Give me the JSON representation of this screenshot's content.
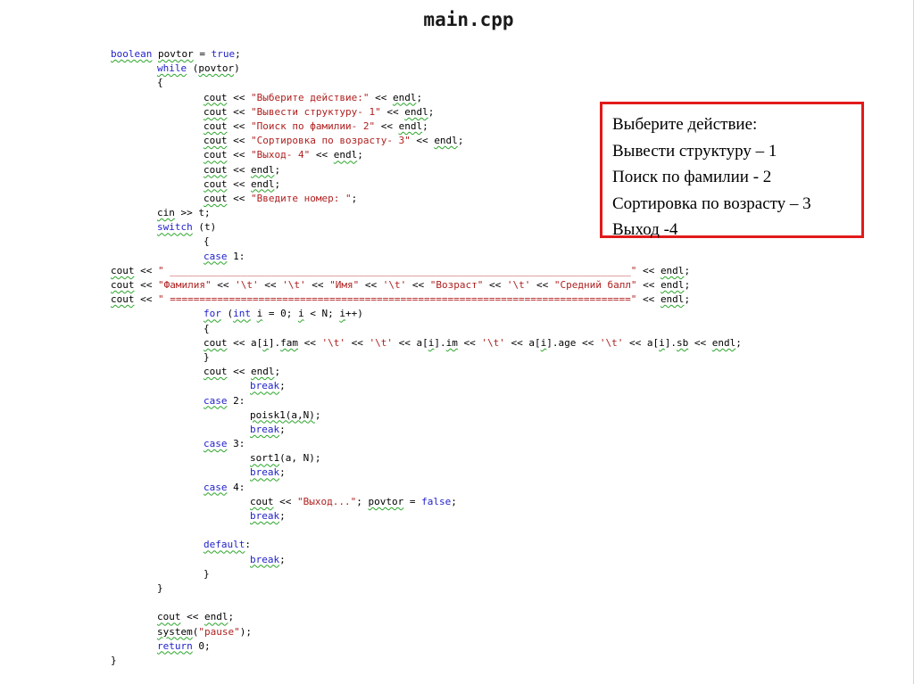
{
  "title": "main.cpp",
  "menu_output": [
    "Выберите действие:",
    "Вывести структуру – 1",
    "Поиск по фамилии - 2",
    "Сортировка по возрасту – 3",
    "Выход -4"
  ],
  "code": [
    {
      "ind": 0,
      "parts": [
        [
          "kw sq",
          "boolean"
        ],
        [
          "nm",
          " "
        ],
        [
          "nm sq",
          "povtor"
        ],
        [
          "nm",
          " = "
        ],
        [
          "kw",
          "true"
        ],
        [
          "nm",
          ";"
        ]
      ]
    },
    {
      "ind": 1,
      "parts": [
        [
          "kw sq",
          "while"
        ],
        [
          "nm",
          " ("
        ],
        [
          "nm sq",
          "povtor"
        ],
        [
          "nm",
          ")"
        ]
      ]
    },
    {
      "ind": 1,
      "parts": [
        [
          "nm",
          "{"
        ]
      ]
    },
    {
      "ind": 2,
      "parts": [
        [
          "nm sq",
          "cout"
        ],
        [
          "nm",
          " << "
        ],
        [
          "st",
          "\"Выберите действие:\""
        ],
        [
          "nm",
          " << "
        ],
        [
          "nm sq",
          "endl"
        ],
        [
          "nm",
          ";"
        ]
      ]
    },
    {
      "ind": 2,
      "parts": [
        [
          "nm sq",
          "cout"
        ],
        [
          "nm",
          " << "
        ],
        [
          "st",
          "\"Вывести структуру- 1\""
        ],
        [
          "nm",
          " << "
        ],
        [
          "nm sq",
          "endl"
        ],
        [
          "nm",
          ";"
        ]
      ]
    },
    {
      "ind": 2,
      "parts": [
        [
          "nm sq",
          "cout"
        ],
        [
          "nm",
          " << "
        ],
        [
          "st",
          "\"Поиск по фамилии- 2\""
        ],
        [
          "nm",
          " << "
        ],
        [
          "nm sq",
          "endl"
        ],
        [
          "nm",
          ";"
        ]
      ]
    },
    {
      "ind": 2,
      "parts": [
        [
          "nm sq",
          "cout"
        ],
        [
          "nm",
          " << "
        ],
        [
          "st",
          "\"Сортировка по возрасту- 3\""
        ],
        [
          "nm",
          " << "
        ],
        [
          "nm sq",
          "endl"
        ],
        [
          "nm",
          ";"
        ]
      ]
    },
    {
      "ind": 2,
      "parts": [
        [
          "nm sq",
          "cout"
        ],
        [
          "nm",
          " << "
        ],
        [
          "st",
          "\"Выход- 4\""
        ],
        [
          "nm",
          " << "
        ],
        [
          "nm sq",
          "endl"
        ],
        [
          "nm",
          ";"
        ]
      ]
    },
    {
      "ind": 2,
      "parts": [
        [
          "nm sq",
          "cout"
        ],
        [
          "nm",
          " << "
        ],
        [
          "nm sq",
          "endl"
        ],
        [
          "nm",
          ";"
        ]
      ]
    },
    {
      "ind": 2,
      "parts": [
        [
          "nm sq",
          "cout"
        ],
        [
          "nm",
          " << "
        ],
        [
          "nm sq",
          "endl"
        ],
        [
          "nm",
          ";"
        ]
      ]
    },
    {
      "ind": 2,
      "parts": [
        [
          "nm sq",
          "cout"
        ],
        [
          "nm",
          " << "
        ],
        [
          "st",
          "\"Введите номер: \""
        ],
        [
          "nm",
          ";"
        ]
      ]
    },
    {
      "ind": 1,
      "parts": [
        [
          "nm sq",
          "cin"
        ],
        [
          "nm",
          " >> t;"
        ]
      ]
    },
    {
      "ind": 1,
      "parts": [
        [
          "kw sq",
          "switch"
        ],
        [
          "nm",
          " (t)"
        ]
      ]
    },
    {
      "ind": 2,
      "parts": [
        [
          "nm",
          "{"
        ]
      ]
    },
    {
      "ind": 2,
      "parts": [
        [
          "kw sq",
          "case"
        ],
        [
          "nm",
          " 1:"
        ]
      ]
    },
    {
      "ind": 0,
      "parts": [
        [
          "nm sq",
          "cout"
        ],
        [
          "nm",
          " << "
        ],
        [
          "st",
          "\" ______________________________________________________________________________\""
        ],
        [
          "nm",
          " << "
        ],
        [
          "nm sq",
          "endl"
        ],
        [
          "nm",
          ";"
        ]
      ]
    },
    {
      "ind": 0,
      "parts": [
        [
          "nm sq",
          "cout"
        ],
        [
          "nm",
          " << "
        ],
        [
          "st",
          "\"Фамилия\""
        ],
        [
          "nm",
          " << "
        ],
        [
          "st",
          "'\\t'"
        ],
        [
          "nm",
          " << "
        ],
        [
          "st",
          "'\\t'"
        ],
        [
          "nm",
          " << "
        ],
        [
          "st",
          "\"Имя\""
        ],
        [
          "nm",
          " << "
        ],
        [
          "st",
          "'\\t'"
        ],
        [
          "nm",
          " << "
        ],
        [
          "st",
          "\"Возраст\""
        ],
        [
          "nm",
          " << "
        ],
        [
          "st",
          "'\\t'"
        ],
        [
          "nm",
          " << "
        ],
        [
          "st",
          "\"Средний балл\""
        ],
        [
          "nm",
          " << "
        ],
        [
          "nm sq",
          "endl"
        ],
        [
          "nm",
          ";"
        ]
      ]
    },
    {
      "ind": 0,
      "parts": [
        [
          "nm sq",
          "cout"
        ],
        [
          "nm",
          " << "
        ],
        [
          "st",
          "\" ==============================================================================\""
        ],
        [
          "nm",
          " << "
        ],
        [
          "nm sq",
          "endl"
        ],
        [
          "nm",
          ";"
        ]
      ]
    },
    {
      "ind": 2,
      "parts": [
        [
          "kw sq",
          "for"
        ],
        [
          "nm",
          " ("
        ],
        [
          "kw sq",
          "int"
        ],
        [
          "nm",
          " "
        ],
        [
          "nm sq",
          "i"
        ],
        [
          "nm",
          " = 0; "
        ],
        [
          "nm sq",
          "i"
        ],
        [
          "nm",
          " < N; "
        ],
        [
          "nm sq",
          "i"
        ],
        [
          "nm",
          "++)"
        ]
      ]
    },
    {
      "ind": 2,
      "parts": [
        [
          "nm",
          "{"
        ]
      ]
    },
    {
      "ind": 2,
      "parts": [
        [
          "nm sq",
          "cout"
        ],
        [
          "nm",
          " << a["
        ],
        [
          "nm sq",
          "i"
        ],
        [
          "nm",
          "]."
        ],
        [
          "nm sq",
          "fam"
        ],
        [
          "nm",
          " << "
        ],
        [
          "st",
          "'\\t'"
        ],
        [
          "nm",
          " << "
        ],
        [
          "st",
          "'\\t'"
        ],
        [
          "nm",
          " << a["
        ],
        [
          "nm sq",
          "i"
        ],
        [
          "nm",
          "]."
        ],
        [
          "nm sq",
          "im"
        ],
        [
          "nm",
          " << "
        ],
        [
          "st",
          "'\\t'"
        ],
        [
          "nm",
          " << a["
        ],
        [
          "nm sq",
          "i"
        ],
        [
          "nm",
          "].age << "
        ],
        [
          "st",
          "'\\t'"
        ],
        [
          "nm",
          " << a["
        ],
        [
          "nm sq",
          "i"
        ],
        [
          "nm",
          "]."
        ],
        [
          "nm sq",
          "sb"
        ],
        [
          "nm",
          " << "
        ],
        [
          "nm sq",
          "endl"
        ],
        [
          "nm",
          ";"
        ]
      ]
    },
    {
      "ind": 2,
      "parts": [
        [
          "nm",
          "}"
        ]
      ]
    },
    {
      "ind": 2,
      "parts": [
        [
          "nm sq",
          "cout"
        ],
        [
          "nm",
          " << "
        ],
        [
          "nm sq",
          "endl"
        ],
        [
          "nm",
          ";"
        ]
      ]
    },
    {
      "ind": 3,
      "parts": [
        [
          "kw sq",
          "break"
        ],
        [
          "nm",
          ";"
        ]
      ]
    },
    {
      "ind": 2,
      "parts": [
        [
          "kw sq",
          "case"
        ],
        [
          "nm",
          " 2:"
        ]
      ]
    },
    {
      "ind": 3,
      "parts": [
        [
          "nm sq",
          "poisk1(a,N)"
        ],
        [
          "nm",
          ";"
        ]
      ]
    },
    {
      "ind": 3,
      "parts": [
        [
          "kw sq",
          "break"
        ],
        [
          "nm",
          ";"
        ]
      ]
    },
    {
      "ind": 2,
      "parts": [
        [
          "kw sq",
          "case"
        ],
        [
          "nm",
          " 3:"
        ]
      ]
    },
    {
      "ind": 3,
      "parts": [
        [
          "nm sq",
          "sort1"
        ],
        [
          "nm",
          "(a, N);"
        ]
      ]
    },
    {
      "ind": 3,
      "parts": [
        [
          "kw sq",
          "break"
        ],
        [
          "nm",
          ";"
        ]
      ]
    },
    {
      "ind": 2,
      "parts": [
        [
          "kw sq",
          "case"
        ],
        [
          "nm",
          " 4:"
        ]
      ]
    },
    {
      "ind": 3,
      "parts": [
        [
          "nm sq",
          "cout"
        ],
        [
          "nm",
          " << "
        ],
        [
          "st",
          "\"Выход...\""
        ],
        [
          "nm",
          "; "
        ],
        [
          "nm sq",
          "povtor"
        ],
        [
          "nm",
          " = "
        ],
        [
          "kw",
          "false"
        ],
        [
          "nm",
          ";"
        ]
      ]
    },
    {
      "ind": 3,
      "parts": [
        [
          "kw sq",
          "break"
        ],
        [
          "nm",
          ";"
        ]
      ]
    },
    {
      "ind": 0,
      "parts": []
    },
    {
      "ind": 2,
      "parts": [
        [
          "kw sq",
          "default"
        ],
        [
          "nm",
          ":"
        ]
      ]
    },
    {
      "ind": 3,
      "parts": [
        [
          "kw sq",
          "break"
        ],
        [
          "nm",
          ";"
        ]
      ]
    },
    {
      "ind": 2,
      "parts": [
        [
          "nm",
          "}"
        ]
      ]
    },
    {
      "ind": 1,
      "parts": [
        [
          "nm",
          "}"
        ]
      ]
    },
    {
      "ind": 0,
      "parts": []
    },
    {
      "ind": 1,
      "parts": [
        [
          "nm sq",
          "cout"
        ],
        [
          "nm",
          " << "
        ],
        [
          "nm sq",
          "endl"
        ],
        [
          "nm",
          ";"
        ]
      ]
    },
    {
      "ind": 1,
      "parts": [
        [
          "nm sq",
          "system"
        ],
        [
          "nm",
          "("
        ],
        [
          "st",
          "\"pause\""
        ],
        [
          "nm",
          ");"
        ]
      ]
    },
    {
      "ind": 1,
      "parts": [
        [
          "kw sq",
          "return"
        ],
        [
          "nm",
          " 0;"
        ]
      ]
    },
    {
      "ind": 0,
      "parts": [
        [
          "nm",
          "}"
        ]
      ]
    }
  ]
}
